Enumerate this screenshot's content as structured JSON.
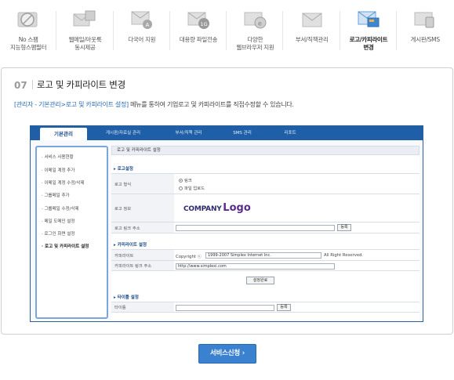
{
  "features": [
    {
      "icon": "no-spam-icon",
      "label_lines": [
        "No 스팸",
        "지능형스팸필터"
      ]
    },
    {
      "icon": "web-mail-icon",
      "label_lines": [
        "웹메일/아웃룩",
        "동시제공"
      ]
    },
    {
      "icon": "multilang-icon",
      "label_lines": [
        "다국어 지원"
      ]
    },
    {
      "icon": "large-file-icon",
      "label_lines": [
        "대용량 파일전송"
      ]
    },
    {
      "icon": "browser-icon",
      "label_lines": [
        "다양한",
        "웹브라우저 지원"
      ]
    },
    {
      "icon": "account-icon",
      "label_lines": [
        "부서/직책관리"
      ]
    },
    {
      "icon": "logo-copyright-icon",
      "label_lines": [
        "로고/카피라이트",
        "변경"
      ],
      "active": true
    },
    {
      "icon": "board-sms-icon",
      "label_lines": [
        "게시판/SMS"
      ]
    }
  ],
  "section": {
    "number": "07",
    "title": "로고 및 카피라이트 변경",
    "desc_highlight": "[관리자 - 기본관리>로고 및 카피라이트 설정]",
    "desc_rest": " 메뉴를 통하여 기업로고 및 카피라이트를 직접수정할 수 있습니다."
  },
  "admin": {
    "topnav": [
      "기본관리",
      "게시판/자료실 관리",
      "부서/직책 관리",
      "SMS 관리",
      "리포트"
    ],
    "sidebar": [
      "서비스 사용현황",
      "이메일 계정 추가",
      "이메일 계정 수정/삭제",
      "그룹메일 추가",
      "그룹메일 수정/삭제",
      "메일 도메인 설정",
      "로그인 화면 설정",
      "로고 및 카피라이트 설정"
    ],
    "page_title": "로고 및 카피라이트 설정",
    "logo_section": {
      "heading": "로고설정",
      "type_label": "로고 형식",
      "type_options": [
        "링크",
        "파일 업로드"
      ],
      "info_label": "로고 정보",
      "logo_text_company": "COMPANY",
      "logo_text_logo": "Logo",
      "link_label": "로고 링크 주소",
      "link_button": "등록"
    },
    "copyright_section": {
      "heading": "카피라이트 설정",
      "copyright_label": "카피라이트",
      "copyright_prefix": "Copyright ⓒ",
      "copyright_value": "1999-2007 Simplex Internet Inc.",
      "copyright_suffix": "All Right Reserved.",
      "link_label": "카피라이트 링크 주소",
      "link_value": "http://www.simplexi.com",
      "save_button": "설정완료"
    },
    "title_section": {
      "heading": "타이틀 설정",
      "title_label": "타이틀",
      "register_button": "등록"
    }
  },
  "service_button": "서비스신청 ›"
}
